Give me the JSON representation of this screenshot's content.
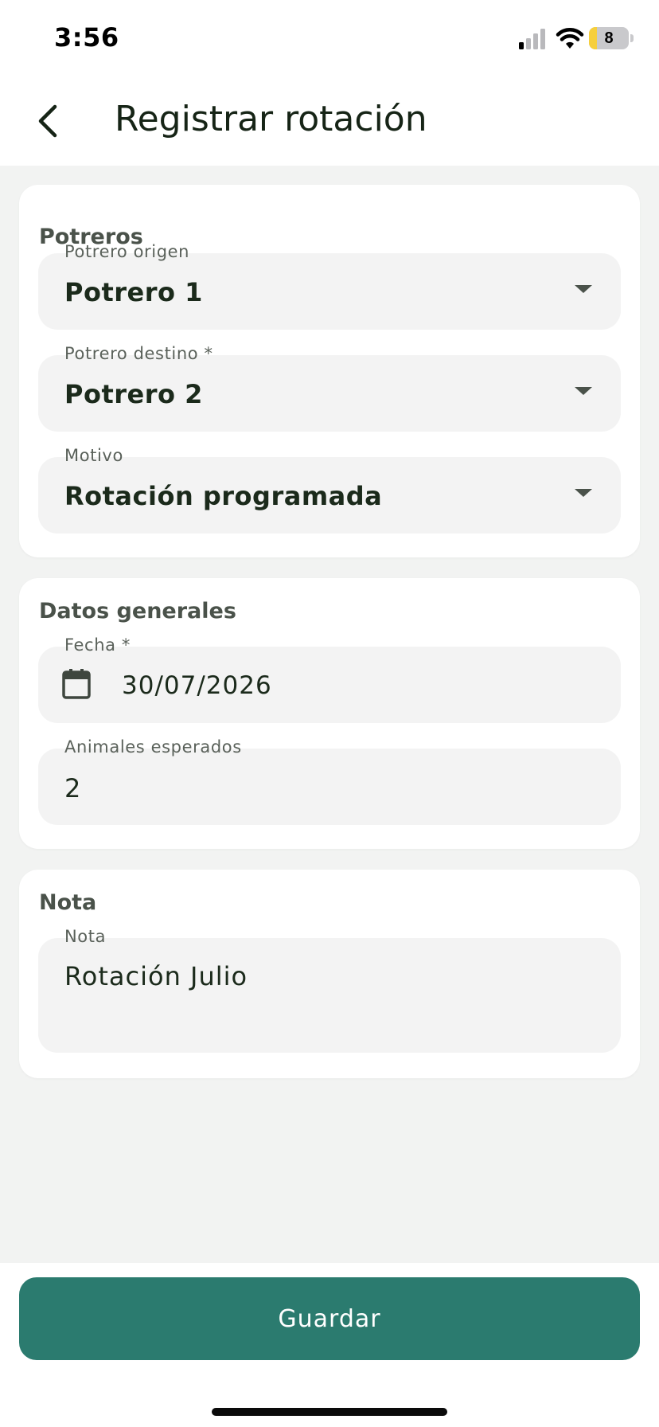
{
  "status_bar": {
    "time": "3:56",
    "battery_level": "8",
    "battery_fraction": 0.2,
    "signal_icon": "cellular-signal-icon",
    "wifi_icon": "wifi-icon"
  },
  "app_bar": {
    "title": "Registrar rotación",
    "back_icon": "chevron-left-icon"
  },
  "sections": {
    "potreros": {
      "title": "Potreros",
      "origin": {
        "label": "Potrero origen",
        "value": "Potrero 1"
      },
      "destination": {
        "label": "Potrero destino *",
        "value": "Potrero 2"
      },
      "reason": {
        "label": "Motivo",
        "value": "Rotación programada"
      }
    },
    "general": {
      "title": "Datos generales",
      "date": {
        "label": "Fecha *",
        "value": "30/07/2026",
        "icon": "calendar-icon"
      },
      "animals": {
        "label": "Animales esperados",
        "value": "2"
      }
    },
    "note": {
      "title": "Nota",
      "field": {
        "label": "Nota",
        "value": "Rotación Julio"
      }
    }
  },
  "footer": {
    "save_label": "Guardar"
  },
  "colors": {
    "primary": "#2b7b6f",
    "background": "#f2f3f2",
    "card": "#ffffff",
    "field": "#f3f3f3",
    "title_text": "#162416",
    "section_title": "#4a524a"
  }
}
